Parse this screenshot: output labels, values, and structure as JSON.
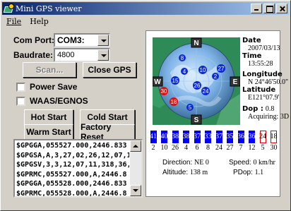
{
  "window": {
    "title": "Mini GPS viewer"
  },
  "menu": {
    "file": "File",
    "help": "Help"
  },
  "com": {
    "label": "Com Port:",
    "value": "COM3:"
  },
  "baud": {
    "label": "Baudrate:",
    "value": "4800"
  },
  "buttons": {
    "scan": "Scan...",
    "close_gps": "Close GPS",
    "hot_start": "Hot Start",
    "cold_start": "Cold Start",
    "warm_start": "Warm Start",
    "factory_reset": "Factory Reset"
  },
  "options": {
    "power_save": "Power Save",
    "waas": "WAAS/EGNOS"
  },
  "nmea": [
    "$GPGGA,055527.000,2446.833",
    "$GPGSA,A,3,27,02,26,12,07,10,",
    "$GPGSV,3,3,12,07,11,318,36,1",
    "$GPRMC,055527.000,A,2446.8",
    "$GPGGA,055528.000,2446.833",
    "$GPRMC,055528.000,A,2446.8"
  ],
  "compass": {
    "n": "N",
    "s": "S",
    "e": "E",
    "w": "W"
  },
  "sky_sats": [
    "8",
    "27",
    "10",
    "2",
    "4",
    "15",
    "30",
    "26",
    "24",
    "18",
    "5"
  ],
  "info": {
    "date_label": "Date",
    "date": "2007/03/13",
    "time_label": "Time",
    "time": "13:55:28",
    "lon_label": "Longitude",
    "lon": "N 24°46'50.0\"",
    "lat_label": "Latitude",
    "lat": "E121°07.9'",
    "dop_label": "Dop",
    "dop": "0.8",
    "acq": "Acquiring: 3D"
  },
  "chart_data": {
    "type": "bar",
    "prn": [
      "2",
      "10",
      "26",
      "4",
      "6",
      "8",
      "24",
      "27",
      "7",
      "12",
      "5",
      "30"
    ],
    "snr": [
      41,
      40,
      38,
      38,
      37,
      33,
      37,
      35,
      36,
      36,
      24,
      18
    ],
    "tracked": [
      true,
      true,
      true,
      true,
      true,
      true,
      true,
      true,
      true,
      true,
      false,
      false
    ]
  },
  "footer": {
    "direction_label": "Direction:",
    "direction": "NE 0",
    "speed_label": "Speed:",
    "speed": "0 km/hr",
    "altitude_label": "Altitude:",
    "altitude": "138 m",
    "pdop_label": "PDop:",
    "pdop": "1.1"
  },
  "colors": {
    "title_start": "#0a246a",
    "title_end": "#a6caf0",
    "bar": "#0000ee",
    "sat_blue": "#0a2bd8",
    "sat_red": "#dd1111",
    "globe_ground": "#2e8b57"
  }
}
